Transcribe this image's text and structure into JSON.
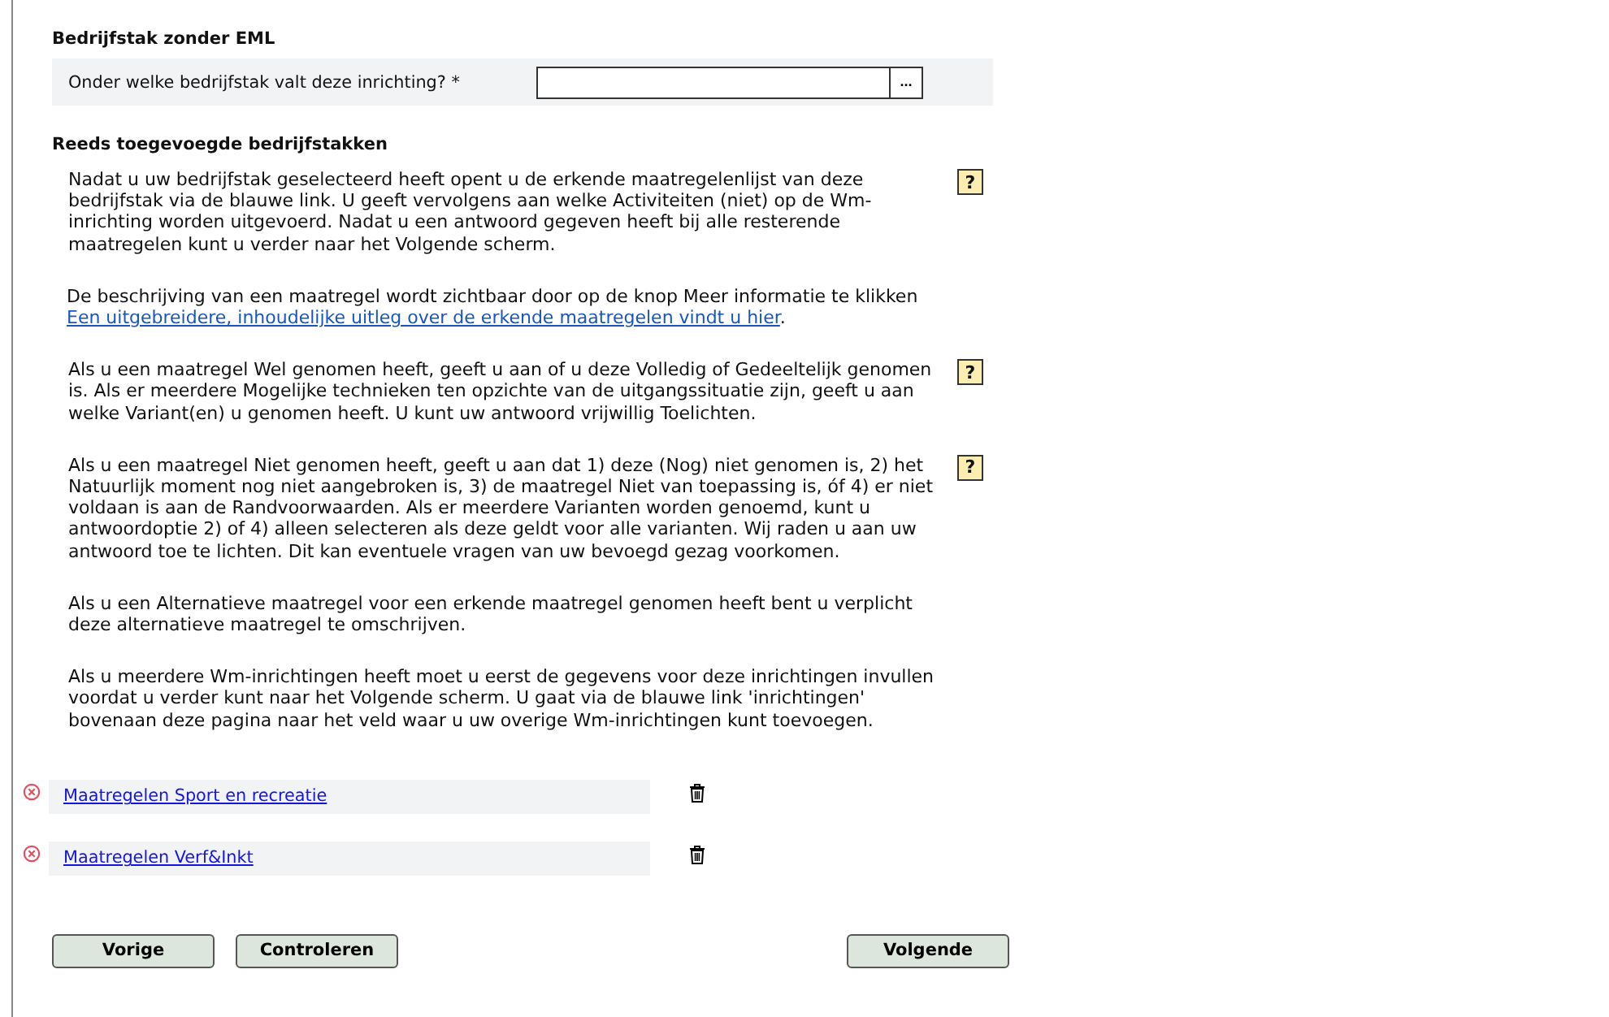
{
  "section_title": "Bedrijfstak zonder EML",
  "question": {
    "label": "Onder welke bedrijfstak valt deze inrichting? *",
    "button": "..."
  },
  "added_title": "Reeds toegevoegde bedrijfstakken",
  "paragraphs": [
    {
      "text": "Nadat u uw bedrijfstak geselecteerd heeft opent u de erkende maatregelenlijst van deze bedrijfstak via de blauwe link. U geeft vervolgens aan welke Activiteiten (niet) op de Wm-inrichting worden uitgevoerd. Nadat u een antwoord gegeven heeft bij alle resterende maatregelen kunt u verder naar het Volgende scherm.",
      "help": true,
      "help_label": "?"
    },
    {
      "text": "De beschrijving van een maatregel wordt zichtbaar door op de knop Meer informatie te klikken ",
      "link": "Een uitgebreidere, inhoudelijke uitleg over de erkende maatregelen vindt u hier",
      "after": ".",
      "help": false
    },
    {
      "text": "Als u een maatregel Wel genomen heeft, geeft u aan of u deze Volledig of Gedeeltelijk genomen is. Als er meerdere Mogelijke technieken ten opzichte van de uitgangssituatie zijn, geeft u aan welke Variant(en) u genomen heeft. U kunt uw antwoord vrijwillig Toelichten.",
      "help": true,
      "help_label": "?"
    },
    {
      "text": "Als u een maatregel Niet genomen heeft, geeft u aan dat 1) deze (Nog) niet genomen is, 2) het Natuurlijk moment nog niet aangebroken is, 3) de maatregel Niet van toepassing is, óf 4) er niet voldaan is aan de Randvoorwaarden.  Als er meerdere Varianten worden genoemd, kunt u antwoordoptie 2) of 4) alleen selecteren als deze geldt voor alle varianten. Wij raden u aan uw antwoord toe te lichten. Dit kan eventuele vragen van uw bevoegd gezag voorkomen.",
      "help": true,
      "help_label": "?"
    },
    {
      "text": "Als u een Alternatieve maatregel voor een erkende maatregel genomen heeft bent u verplicht deze alternatieve maatregel te omschrijven.",
      "help": false
    },
    {
      "text": "Als u meerdere Wm-inrichtingen heeft moet u eerst de gegevens voor deze inrichtingen invullen voordat u verder kunt naar het Volgende scherm. U gaat via de blauwe link 'inrichtingen' bovenaan deze pagina naar het veld waar u uw overige Wm-inrichtingen kunt toevoegen.",
      "help": false
    }
  ],
  "entries": [
    {
      "link": "Maatregelen Sport en recreatie"
    },
    {
      "link": "Maatregelen Verf&Inkt"
    }
  ],
  "buttons": {
    "left": [
      "Vorige",
      "Controleren"
    ],
    "right": [
      "Volgende"
    ]
  }
}
